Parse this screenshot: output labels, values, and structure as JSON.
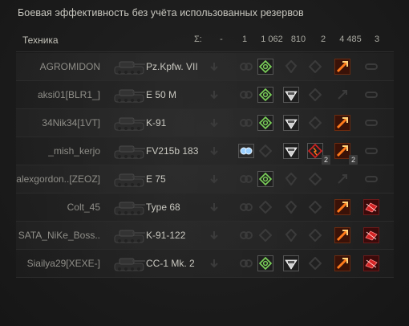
{
  "window": {
    "title": "Боевая эффективность без учёта использованных резервов"
  },
  "header": {
    "vehicle_label": "Техника",
    "sigma": "Σ:",
    "columns": [
      "-",
      "1",
      "1 062",
      "810",
      "2",
      "4 485",
      "3"
    ]
  },
  "rows": [
    {
      "player": "AGROMIDON",
      "tank": "Pz.Kpfw. VII",
      "cells": [
        "dim-arrow",
        "dim-eye",
        "spot-active",
        "dim-shield",
        "dim-diamond",
        "fire-active",
        "dim-track"
      ],
      "counts": [
        "",
        "",
        "",
        "",
        "",
        "",
        ""
      ]
    },
    {
      "player": "aksi01[BLR1_]",
      "tank": "E 50 M",
      "cells": [
        "dim-arrow",
        "dim-eye",
        "spot-active",
        "assist-active",
        "dim-diamond",
        "dim-fire",
        "dim-track"
      ],
      "counts": [
        "",
        "",
        "",
        "",
        "",
        "",
        ""
      ]
    },
    {
      "player": "34Nik34[1VT]",
      "tank": "K-91",
      "cells": [
        "dim-arrow",
        "dim-eye",
        "spot-active",
        "assist-active",
        "dim-diamond",
        "fire-active",
        "dim-track"
      ],
      "counts": [
        "",
        "",
        "",
        "",
        "",
        "",
        ""
      ]
    },
    {
      "player": "_mish_kerjo",
      "tank": "FV215b 183",
      "cells": [
        "dim-arrow",
        "eye-active",
        "dim-spot",
        "assist-active",
        "crit-active",
        "fire-active",
        "dim-track"
      ],
      "counts": [
        "",
        "",
        "",
        "",
        "2",
        "2",
        ""
      ]
    },
    {
      "player": "alexgordon..[ZEOZ]",
      "tank": "E 75",
      "cells": [
        "dim-arrow",
        "dim-eye",
        "spot-active",
        "dim-shield",
        "dim-diamond",
        "dim-fire",
        "dim-track"
      ],
      "counts": [
        "",
        "",
        "",
        "",
        "",
        "",
        ""
      ]
    },
    {
      "player": "Colt_45",
      "tank": "Type 68",
      "cells": [
        "dim-arrow",
        "dim-eye",
        "dim-spot",
        "dim-shield",
        "dim-diamond",
        "fire-active",
        "kill-active"
      ],
      "counts": [
        "",
        "",
        "",
        "",
        "",
        "",
        ""
      ]
    },
    {
      "player": "SATA_NiKe_Boss..",
      "tank": "K-91-122",
      "cells": [
        "dim-arrow",
        "dim-eye",
        "dim-spot",
        "dim-shield",
        "dim-diamond",
        "fire-active",
        "kill-active"
      ],
      "counts": [
        "",
        "",
        "",
        "",
        "",
        "",
        ""
      ]
    },
    {
      "player": "Siailya29[XEXE-]",
      "tank": "CC-1 Mk. 2",
      "cells": [
        "dim-arrow",
        "dim-eye",
        "spot-active",
        "assist-active",
        "dim-diamond",
        "fire-active",
        "kill-active"
      ],
      "counts": [
        "",
        "",
        "",
        "",
        "",
        "",
        ""
      ]
    }
  ],
  "colors": {
    "spot_green": "#7cd35a",
    "fire_orange": "#ff7a1a",
    "kill_red": "#d42222",
    "dim_icon": "#3b3b3b"
  }
}
